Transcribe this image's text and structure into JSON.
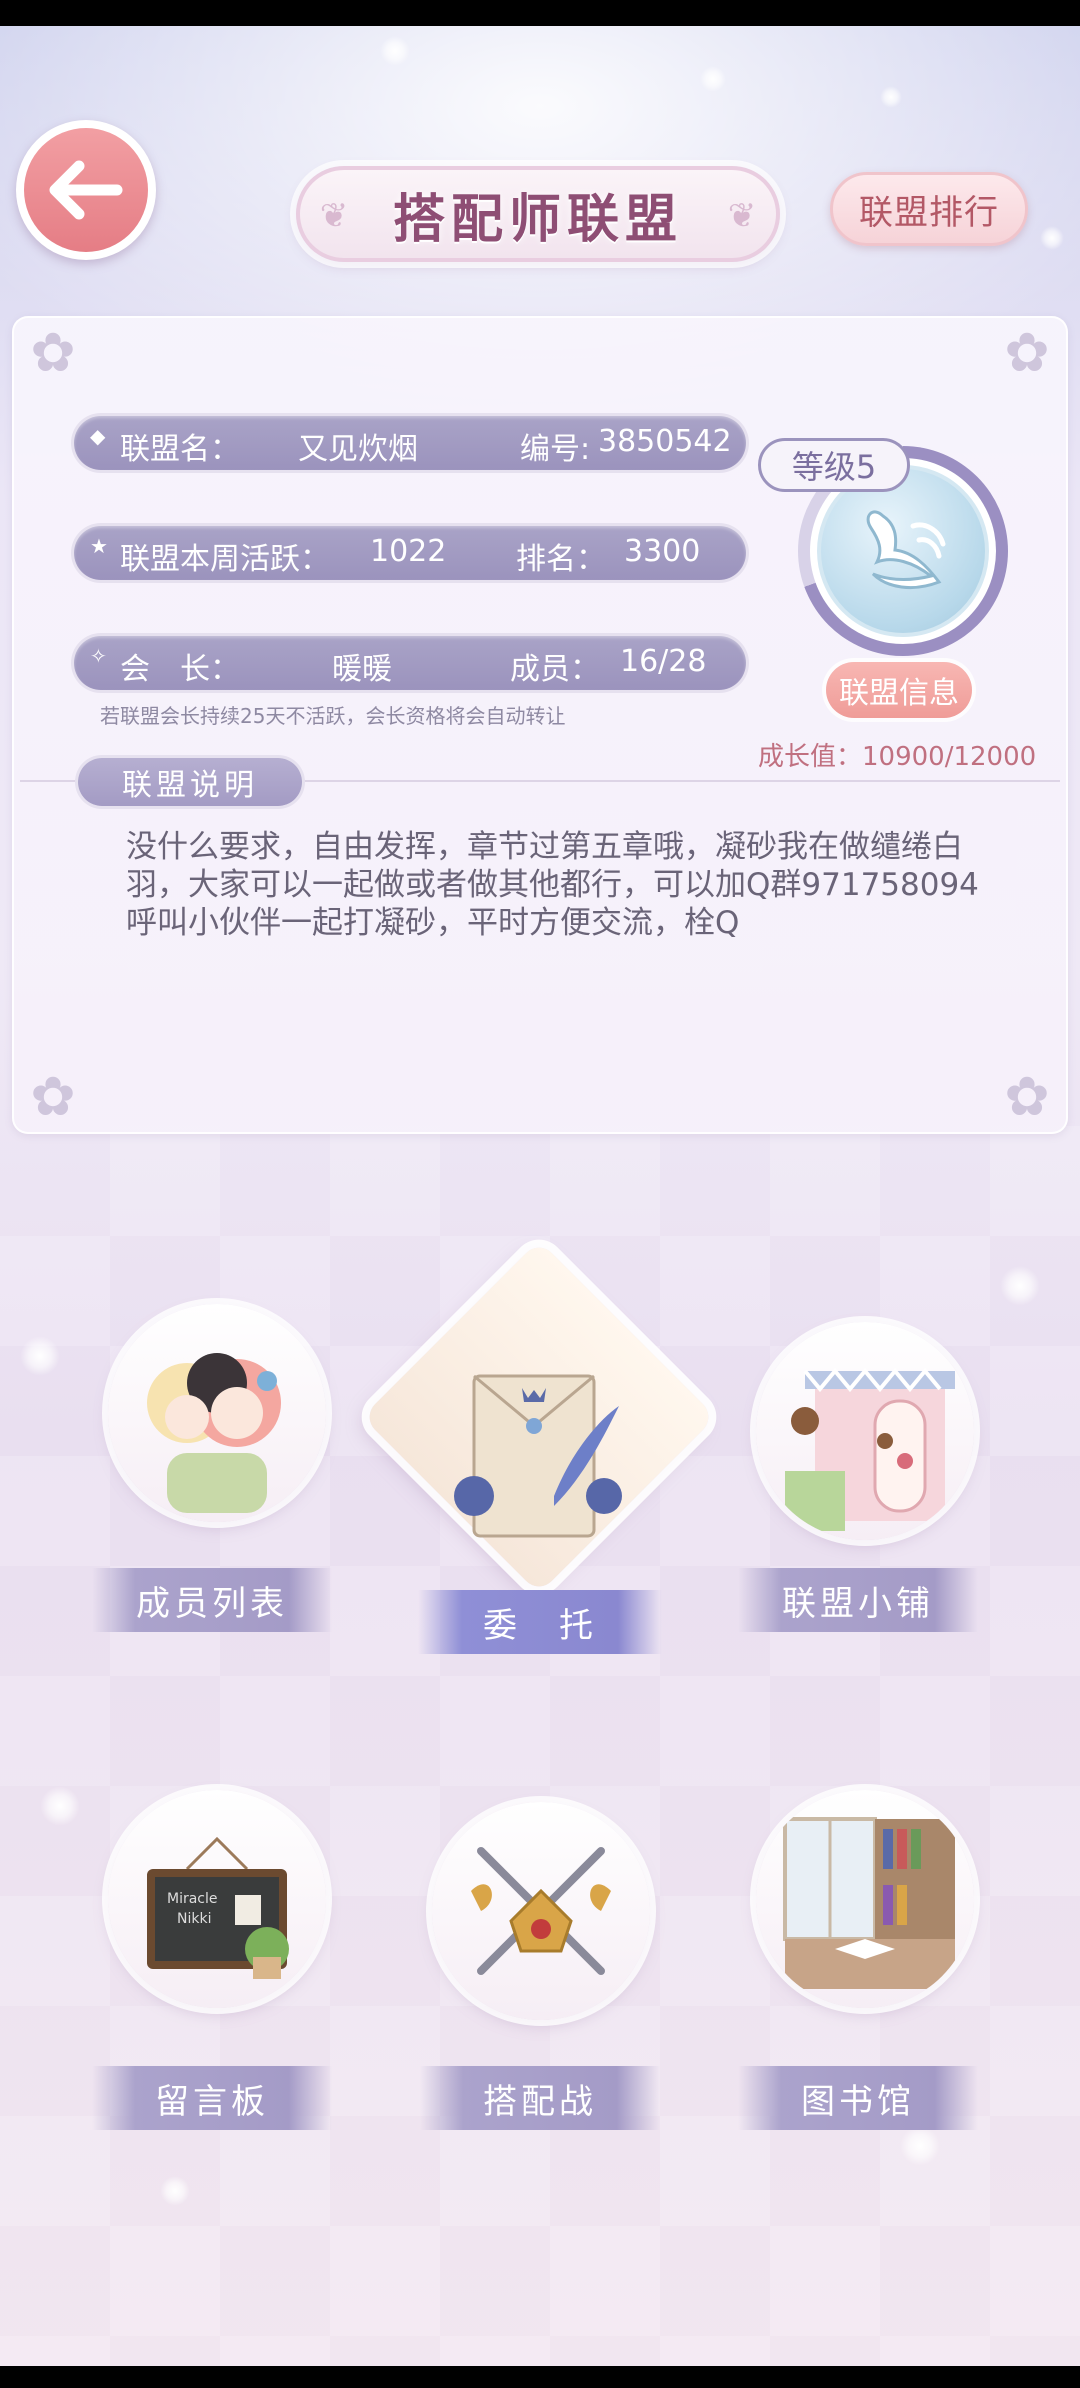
{
  "header": {
    "title": "搭配师联盟",
    "rank_button": "联盟排行",
    "back_icon": "arrow-left-icon"
  },
  "alliance": {
    "name_label": "联盟名：",
    "name_value": "又见炊烟",
    "id_label": "编号:",
    "id_value": "3850542",
    "level": "等级5",
    "activity_label": "联盟本周活跃：",
    "activity_value": "1022",
    "rank_label": "排名：",
    "rank_value": "3300",
    "leader_label": "会　长：",
    "leader_value": "暖暖",
    "members_label": "成员：",
    "members_value": "16/28",
    "info_button": "联盟信息",
    "notice": "若联盟会长持续25天不活跃，会长资格将会自动转让",
    "growth": "成长值：10900/12000",
    "desc_title": "联盟说明",
    "description": "没什么要求，自由发挥，章节过第五章哦，凝砂我在做缱绻白羽，大家可以一起做或者做其他都行，可以加Q群971758094呼叫小伙伴一起打凝砂，平时方便交流，栓Q"
  },
  "features": [
    {
      "label": "成员列表",
      "icon": "members-icon"
    },
    {
      "label": "委　托",
      "icon": "commission-letter-icon"
    },
    {
      "label": "联盟小铺",
      "icon": "shop-icon"
    },
    {
      "label": "留言板",
      "icon": "message-board-icon"
    },
    {
      "label": "搭配战",
      "icon": "crossed-swords-icon"
    },
    {
      "label": "图书馆",
      "icon": "library-icon"
    }
  ],
  "colors": {
    "accent": "#9b93bd",
    "title": "#8e4e74",
    "back_button": "#e57d85",
    "info_button": "#ef9c98"
  }
}
